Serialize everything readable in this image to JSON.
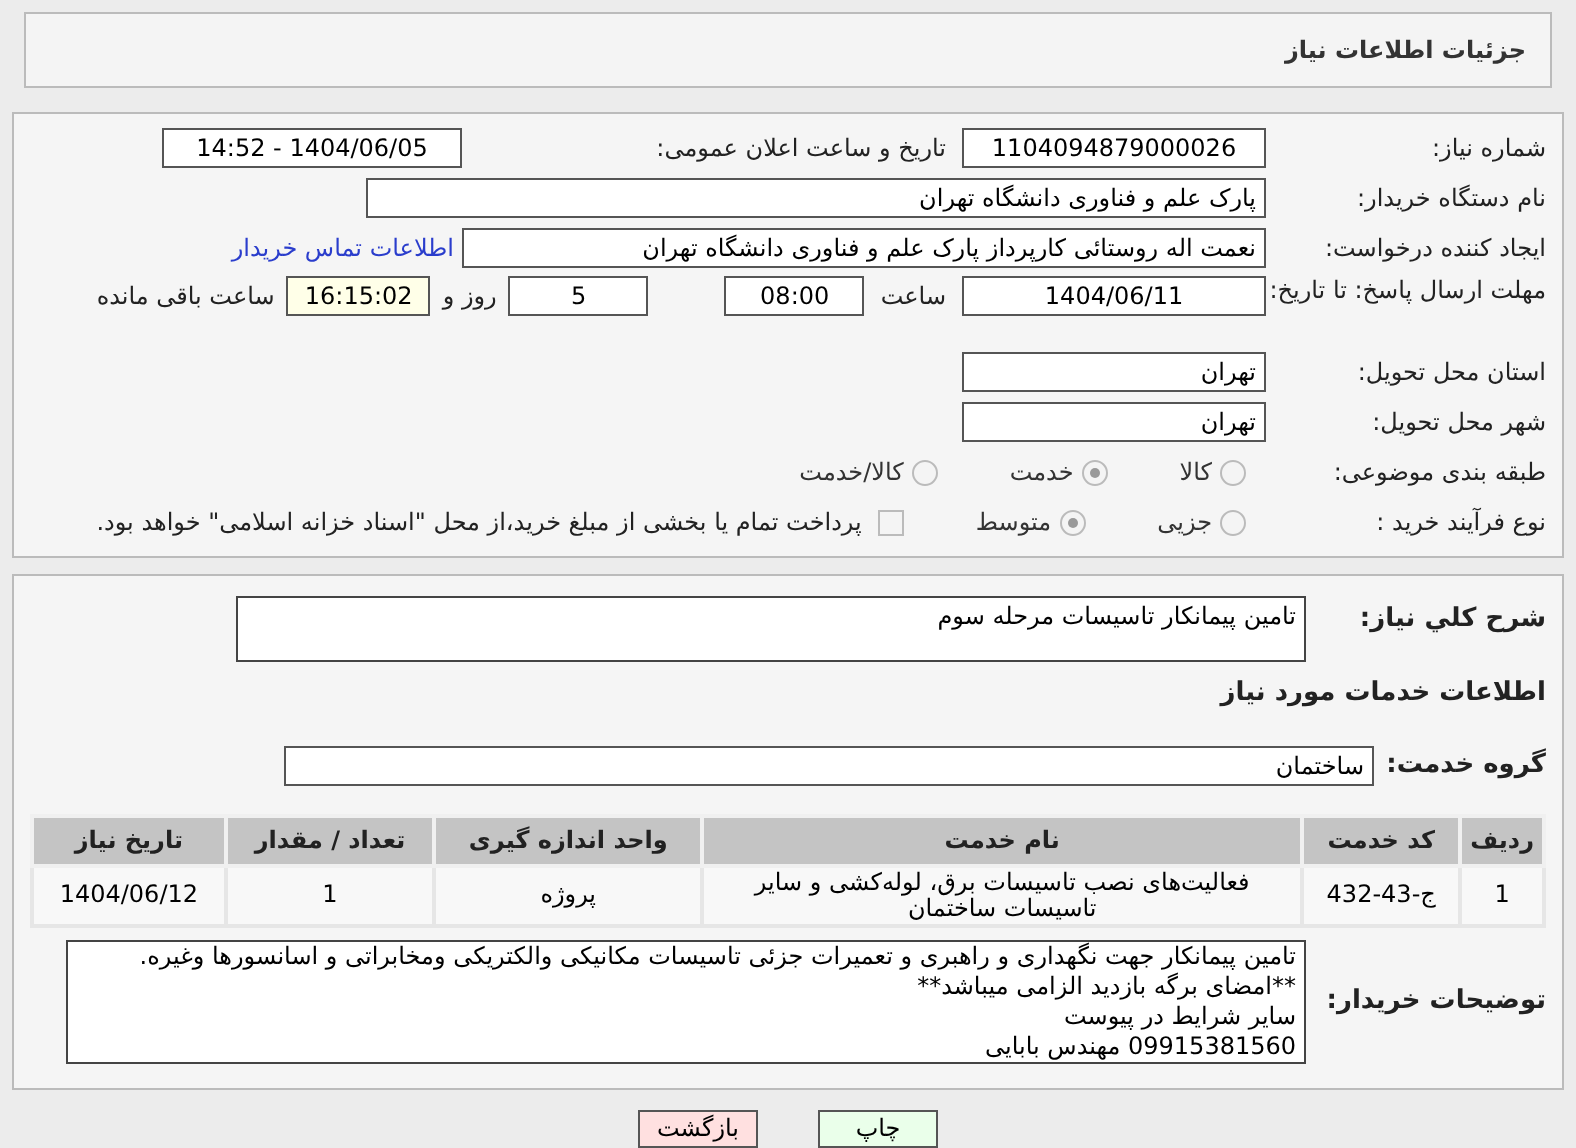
{
  "header": {
    "title": "جزئیات اطلاعات نیاز"
  },
  "details": {
    "need_number": {
      "label": "شماره نیاز:",
      "value": "1104094879000026"
    },
    "announce": {
      "label": "تاریخ و ساعت اعلان عمومی:",
      "value": "1404/06/05 - 14:52"
    },
    "buyer": {
      "label": "نام دستگاه خریدار:",
      "value": "پارک علم و فناوری دانشگاه تهران"
    },
    "creator": {
      "label": "ایجاد کننده درخواست:",
      "value": "نعمت اله روستائی کارپرداز پارک علم و فناوری دانشگاه تهران",
      "link": "اطلاعات تماس خریدار"
    },
    "deadline": {
      "label": "مهلت ارسال پاسخ: تا تاریخ:",
      "date": "1404/06/11",
      "time_label": "ساعت",
      "time": "08:00",
      "days": "5",
      "days_label": "روز و",
      "remaining": "16:15:02",
      "remaining_label": "ساعت باقی مانده"
    },
    "province": {
      "label": "استان محل تحویل:",
      "value": "تهران"
    },
    "city": {
      "label": "شهر محل تحویل:",
      "value": "تهران"
    },
    "category": {
      "label": "طبقه بندی موضوعی:",
      "options": [
        {
          "label": "کالا",
          "selected": false
        },
        {
          "label": "خدمت",
          "selected": true
        },
        {
          "label": "کالا/خدمت",
          "selected": false
        }
      ]
    },
    "process": {
      "label": "نوع فرآیند خرید :",
      "options": [
        {
          "label": "جزیی",
          "selected": false
        },
        {
          "label": "متوسط",
          "selected": true
        }
      ],
      "payment": {
        "label": "پرداخت تمام یا بخشی از مبلغ خرید،از محل \"اسناد خزانه اسلامی\" خواهد بود.",
        "checked": false
      }
    }
  },
  "services": {
    "summary": {
      "label": "شرح کلي نیاز:",
      "value": "تامین پیمانکار تاسیسات مرحله سوم"
    },
    "heading": "اطلاعات خدمات مورد نیاز",
    "group": {
      "label": "گروه خدمت:",
      "value": "ساختمان"
    },
    "table": {
      "columns": [
        "ردیف",
        "کد خدمت",
        "نام خدمت",
        "واحد اندازه گیری",
        "تعداد / مقدار",
        "تاریخ نیاز"
      ],
      "rows": [
        [
          "1",
          "ج-43-432",
          "فعالیت‌های نصب تاسیسات برق، لوله‌کشی و سایر تاسیسات ساختمان",
          "پروژه",
          "1",
          "1404/06/12"
        ]
      ]
    },
    "notes": {
      "label": "توضیحات خریدار:",
      "lines": [
        "تامین پیمانکار جهت نگهداری و راهبری و تعمیرات جزئی تاسیسات مکانیکی والکتریکی ومخابراتی و اسانسورها وغیره.",
        "**امضای برگه بازدید الزامی میباشد**",
        "سایر شرایط در پیوست",
        "09915381560 مهندس بابایی"
      ]
    }
  },
  "buttons": [
    {
      "label": "چاپ",
      "kind": "print"
    },
    {
      "label": "بازگشت",
      "kind": "back"
    }
  ]
}
